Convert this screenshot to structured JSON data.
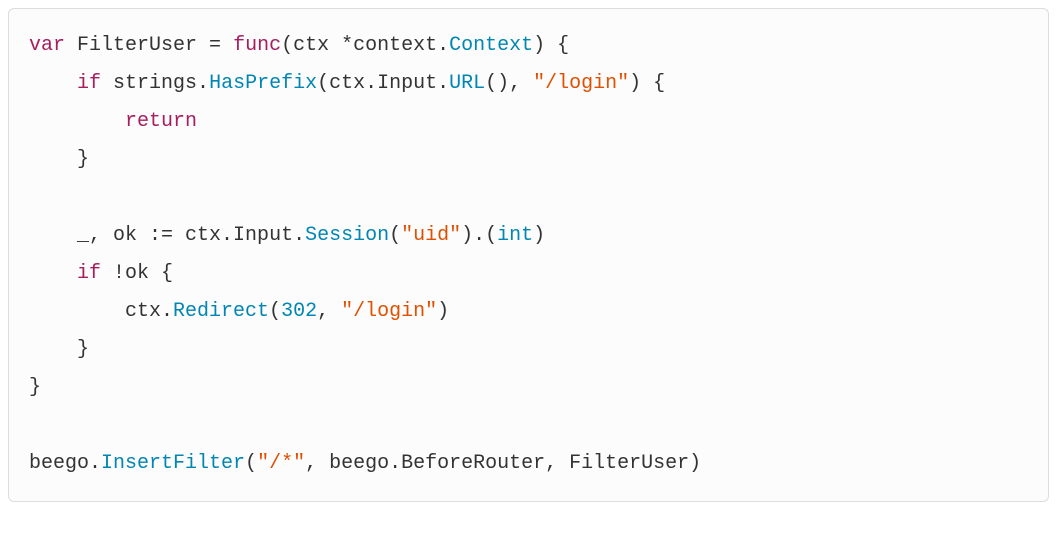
{
  "code": {
    "tokens": [
      {
        "cls": "kw",
        "t": "var"
      },
      {
        "cls": "plain",
        "t": " FilterUser "
      },
      {
        "cls": "plain",
        "t": "="
      },
      {
        "cls": "plain",
        "t": " "
      },
      {
        "cls": "kw",
        "t": "func"
      },
      {
        "cls": "plain",
        "t": "(ctx "
      },
      {
        "cls": "plain",
        "t": "*"
      },
      {
        "cls": "plain",
        "t": "context"
      },
      {
        "cls": "plain",
        "t": "."
      },
      {
        "cls": "type",
        "t": "Context"
      },
      {
        "cls": "plain",
        "t": ") {"
      },
      {
        "cls": "nl",
        "t": "\n"
      },
      {
        "cls": "plain",
        "t": "    "
      },
      {
        "cls": "kw",
        "t": "if"
      },
      {
        "cls": "plain",
        "t": " strings."
      },
      {
        "cls": "fn",
        "t": "HasPrefix"
      },
      {
        "cls": "plain",
        "t": "(ctx.Input."
      },
      {
        "cls": "fn",
        "t": "URL"
      },
      {
        "cls": "plain",
        "t": "(), "
      },
      {
        "cls": "str",
        "t": "\"/login\""
      },
      {
        "cls": "plain",
        "t": ") {"
      },
      {
        "cls": "nl",
        "t": "\n"
      },
      {
        "cls": "plain",
        "t": "        "
      },
      {
        "cls": "kw",
        "t": "return"
      },
      {
        "cls": "nl",
        "t": "\n"
      },
      {
        "cls": "plain",
        "t": "    }"
      },
      {
        "cls": "nl",
        "t": "\n"
      },
      {
        "cls": "nl",
        "t": "\n"
      },
      {
        "cls": "plain",
        "t": "    _, ok "
      },
      {
        "cls": "plain",
        "t": ":="
      },
      {
        "cls": "plain",
        "t": " ctx.Input."
      },
      {
        "cls": "fn",
        "t": "Session"
      },
      {
        "cls": "plain",
        "t": "("
      },
      {
        "cls": "str",
        "t": "\"uid\""
      },
      {
        "cls": "plain",
        "t": ").("
      },
      {
        "cls": "type",
        "t": "int"
      },
      {
        "cls": "plain",
        "t": ")"
      },
      {
        "cls": "nl",
        "t": "\n"
      },
      {
        "cls": "plain",
        "t": "    "
      },
      {
        "cls": "kw",
        "t": "if"
      },
      {
        "cls": "plain",
        "t": " !ok {"
      },
      {
        "cls": "nl",
        "t": "\n"
      },
      {
        "cls": "plain",
        "t": "        ctx."
      },
      {
        "cls": "fn",
        "t": "Redirect"
      },
      {
        "cls": "plain",
        "t": "("
      },
      {
        "cls": "num",
        "t": "302"
      },
      {
        "cls": "plain",
        "t": ", "
      },
      {
        "cls": "str",
        "t": "\"/login\""
      },
      {
        "cls": "plain",
        "t": ")"
      },
      {
        "cls": "nl",
        "t": "\n"
      },
      {
        "cls": "plain",
        "t": "    }"
      },
      {
        "cls": "nl",
        "t": "\n"
      },
      {
        "cls": "plain",
        "t": "}"
      },
      {
        "cls": "nl",
        "t": "\n"
      },
      {
        "cls": "nl",
        "t": "\n"
      },
      {
        "cls": "plain",
        "t": "beego."
      },
      {
        "cls": "fn",
        "t": "InsertFilter"
      },
      {
        "cls": "plain",
        "t": "("
      },
      {
        "cls": "str",
        "t": "\"/*\""
      },
      {
        "cls": "plain",
        "t": ", beego.BeforeRouter, FilterUser)"
      }
    ]
  }
}
